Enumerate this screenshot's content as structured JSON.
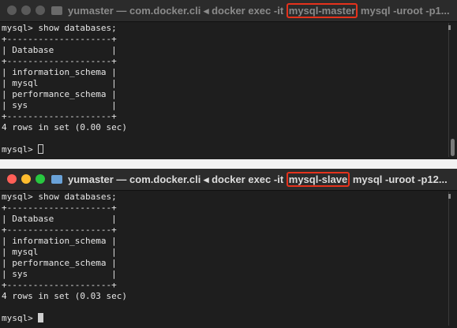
{
  "window_top": {
    "title_prefix": "yumaster — com.docker.cli ◂ docker exec -it ",
    "title_highlight": "mysql-master",
    "title_suffix": " mysql -uroot -p1...",
    "lines": [
      "mysql> show databases;",
      "+--------------------+",
      "| Database           |",
      "+--------------------+",
      "| information_schema |",
      "| mysql              |",
      "| performance_schema |",
      "| sys                |",
      "+--------------------+",
      "4 rows in set (0.00 sec)",
      ""
    ],
    "prompt": "mysql> "
  },
  "window_bottom": {
    "title_prefix": "yumaster — com.docker.cli ◂ docker exec -it ",
    "title_highlight": "mysql-slave",
    "title_suffix": " mysql -uroot -p12...",
    "lines": [
      "mysql> show databases;",
      "+--------------------+",
      "| Database           |",
      "+--------------------+",
      "| information_schema |",
      "| mysql              |",
      "| performance_schema |",
      "| sys                |",
      "+--------------------+",
      "4 rows in set (0.03 sec)",
      ""
    ],
    "prompt": "mysql> "
  },
  "icons": {
    "window_buttons": [
      "close-icon",
      "minimize-icon",
      "zoom-icon"
    ],
    "folder": "folder-icon"
  },
  "colors": {
    "highlight_border": "#e5321c",
    "terminal_bg": "#1e1e1e",
    "close": "#ff5f57",
    "minimize": "#febc2e",
    "zoom": "#28c840"
  }
}
